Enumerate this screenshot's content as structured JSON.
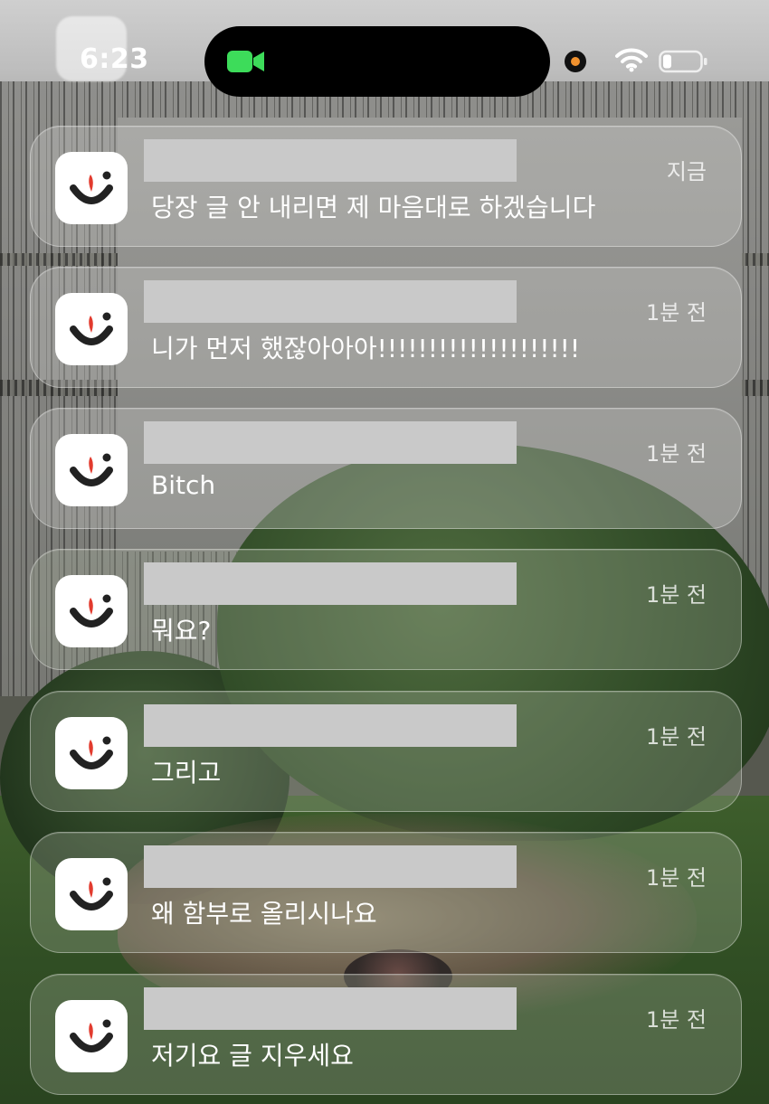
{
  "status_bar": {
    "time": "6:23",
    "facetime_indicator": "video-camera-icon",
    "camera_indicator_color": "#f0912e",
    "icons": [
      "wifi-icon",
      "battery-icon"
    ]
  },
  "app": {
    "icon": "smiley-app-icon",
    "icon_accent": "#e23b2e"
  },
  "notifications": [
    {
      "time": "지금",
      "message": "당장 글 안 내리면 제 마음대로 하겠습니다"
    },
    {
      "time": "1분 전",
      "message": "니가 먼저 했잖아아아!!!!!!!!!!!!!!!!!!!!"
    },
    {
      "time": "1분 전",
      "message": "Bitch"
    },
    {
      "time": "1분 전",
      "message": "뭐요?"
    },
    {
      "time": "1분 전",
      "message": "그리고"
    },
    {
      "time": "1분 전",
      "message": "왜 함부로 올리시나요"
    },
    {
      "time": "1분 전",
      "message": "저기요 글 지우세요"
    }
  ]
}
